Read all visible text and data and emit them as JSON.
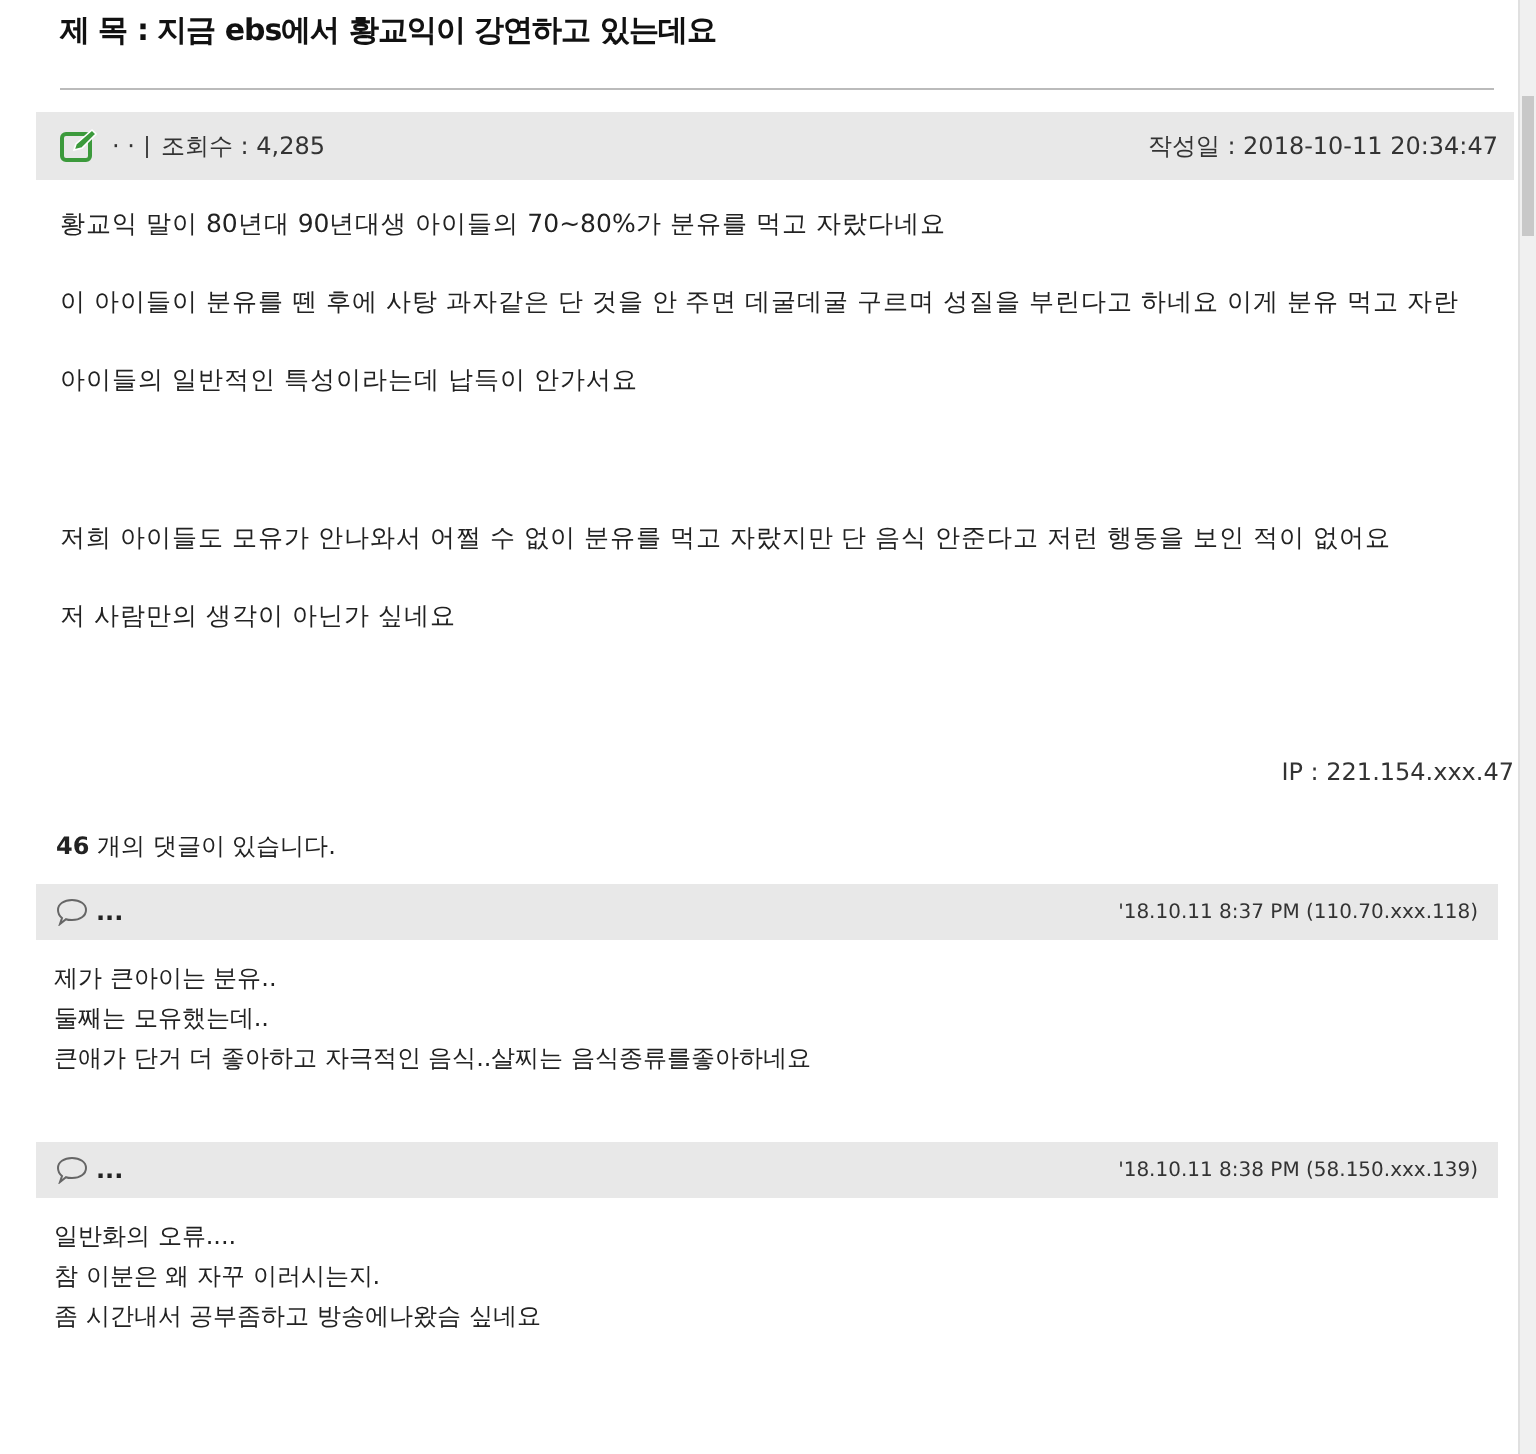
{
  "post": {
    "title_label": "제 목 :",
    "title": "지금 ebs에서 황교익이 강연하고 있는데요",
    "author": "· ·",
    "views_label": "조회수 : 4,285",
    "date_label": "작성일 : 2018-10-11 20:34:47",
    "body_groups": [
      [
        "황교익 말이 80년대 90년대생 아이들의 70~80%가 분유를 먹고 자랐다네요",
        "이 아이들이 분유를 뗀 후에 사탕 과자같은 단 것을 안 주면 데굴데굴 구르며 성질을 부린다고 하네요 이게 분유 먹고 자란",
        "아이들의 일반적인 특성이라는데 납득이 안가서요"
      ],
      [
        "저희 아이들도 모유가 안나와서 어쩔 수 없이 분유를 먹고 자랐지만 단 음식 안준다고 저런 행동을 보인 적이 없어요",
        "저 사람만의 생각이 아닌가 싶네요"
      ]
    ],
    "ip": "IP : 221.154.xxx.47"
  },
  "comment_count": {
    "count": "46",
    "label": "개의 댓글이 있습니다."
  },
  "comments": [
    {
      "author": "...",
      "meta": "'18.10.11 8:37 PM (110.70.xxx.118)",
      "lines": [
        "제가 큰아이는 분유..",
        "둘째는 모유했는데..",
        "큰애가 단거 더 좋아하고 자극적인 음식..살찌는 음식종류를좋아하네요"
      ]
    },
    {
      "author": "...",
      "meta": "'18.10.11 8:38 PM (58.150.xxx.139)",
      "lines": [
        "일반화의 오류....",
        "참 이분은 왜 자꾸 이러시는지.",
        "좀 시간내서 공부좀하고 방송에나왔슴 싶네요"
      ]
    }
  ]
}
